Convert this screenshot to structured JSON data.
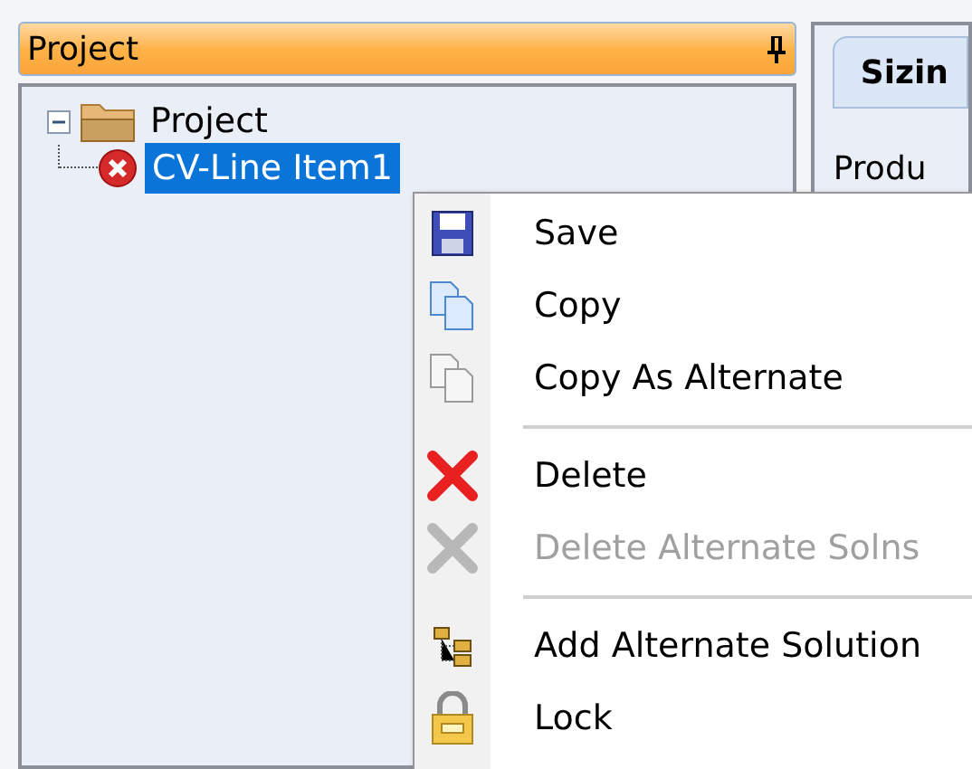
{
  "project_panel": {
    "title": "Project",
    "tree": [
      {
        "label": "Project",
        "expanded": true,
        "selected": false,
        "children": [
          {
            "label": "CV-Line Item1",
            "selected": true,
            "error": true
          }
        ]
      }
    ]
  },
  "right_panel": {
    "tabs": [
      {
        "label": "Sizin",
        "selected": true
      }
    ],
    "field_label": "Produ"
  },
  "context_menu": {
    "items": [
      {
        "kind": "item",
        "label": "Save",
        "disabled": false
      },
      {
        "kind": "item",
        "label": "Copy",
        "disabled": false
      },
      {
        "kind": "item",
        "label": "Copy As Alternate",
        "disabled": false
      },
      {
        "kind": "separator"
      },
      {
        "kind": "item",
        "label": "Delete",
        "disabled": false
      },
      {
        "kind": "item",
        "label": "Delete Alternate Solns",
        "disabled": true
      },
      {
        "kind": "separator"
      },
      {
        "kind": "item",
        "label": "Add Alternate Solution",
        "disabled": false
      },
      {
        "kind": "item",
        "label": "Lock",
        "disabled": false
      }
    ]
  }
}
